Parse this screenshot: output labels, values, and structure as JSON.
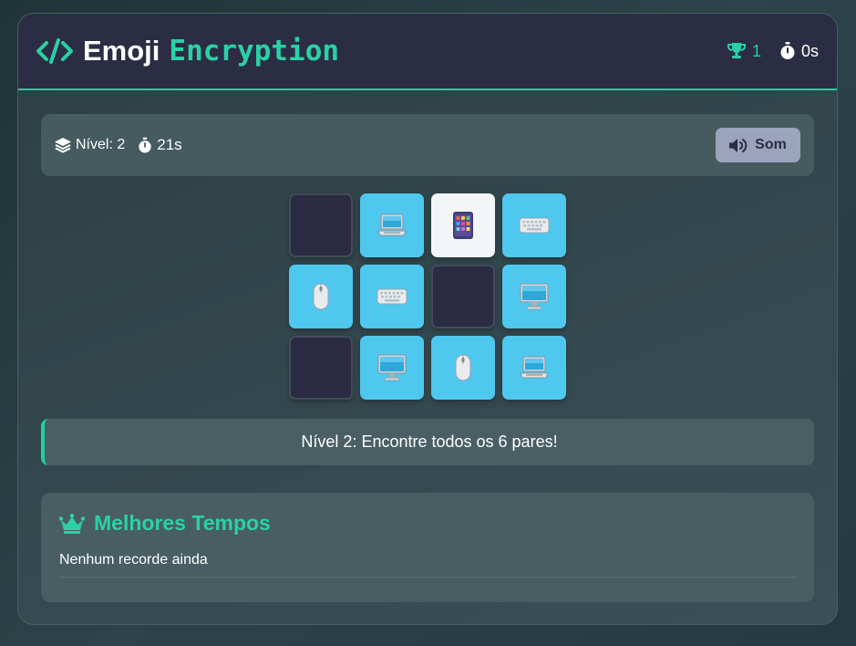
{
  "header": {
    "title_part1": "Emoji",
    "title_part2": "Encryption",
    "trophies": "1",
    "timer": "0s"
  },
  "infobar": {
    "level_label": "Nível: 2",
    "time": "21s",
    "sound_label": "Som"
  },
  "board": {
    "cards": [
      {
        "state": "hidden",
        "icon": "none"
      },
      {
        "state": "matched",
        "icon": "laptop-icon"
      },
      {
        "state": "flipped",
        "icon": "tablet-icon"
      },
      {
        "state": "matched",
        "icon": "keyboard-icon"
      },
      {
        "state": "matched",
        "icon": "mouse-icon"
      },
      {
        "state": "matched",
        "icon": "keyboard-icon"
      },
      {
        "state": "hidden",
        "icon": "none"
      },
      {
        "state": "matched",
        "icon": "desktop-icon"
      },
      {
        "state": "hidden",
        "icon": "none"
      },
      {
        "state": "matched",
        "icon": "desktop-icon"
      },
      {
        "state": "matched",
        "icon": "mouse-icon"
      },
      {
        "state": "matched",
        "icon": "laptop-icon"
      }
    ]
  },
  "message": "Nível 2: Encontre todos os 6 pares!",
  "records": {
    "title": "Melhores Tempos",
    "empty_text": "Nenhum recorde ainda"
  },
  "colors": {
    "accent": "#2ad1a5",
    "header_bg": "#2b2d45",
    "card_matched": "#4ec8ef",
    "card_hidden": "#2b2c43",
    "card_flipped": "#f3f5f7",
    "sound_button": "#9aa4bd"
  }
}
